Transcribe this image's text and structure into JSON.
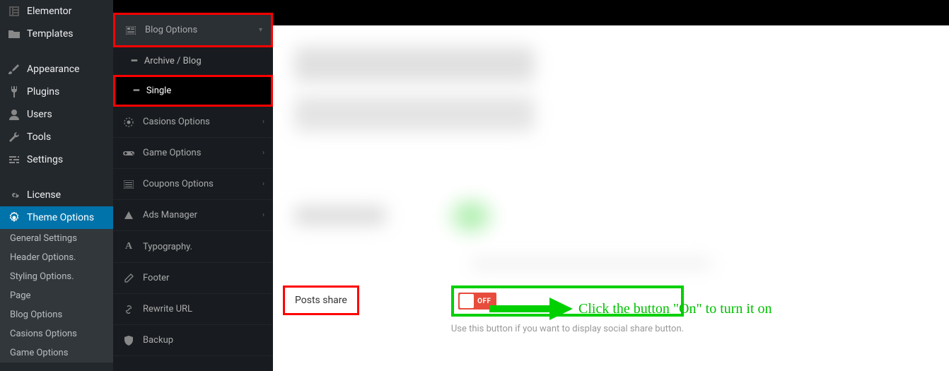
{
  "wp_sidebar": {
    "items": [
      {
        "label": "Elementor"
      },
      {
        "label": "Templates"
      },
      {
        "label": "Appearance"
      },
      {
        "label": "Plugins"
      },
      {
        "label": "Users"
      },
      {
        "label": "Tools"
      },
      {
        "label": "Settings"
      },
      {
        "label": "License"
      },
      {
        "label": "Theme Options"
      }
    ],
    "sub": [
      {
        "label": "General Settings"
      },
      {
        "label": "Header Options."
      },
      {
        "label": "Styling Options."
      },
      {
        "label": "Page"
      },
      {
        "label": "Blog Options"
      },
      {
        "label": "Casions Options"
      },
      {
        "label": "Game Options"
      }
    ]
  },
  "opts_sidebar": {
    "blog_options": "Blog Options",
    "archive": "Archive / Blog",
    "single": "Single",
    "items": [
      {
        "label": "Casions Options"
      },
      {
        "label": "Game Options"
      },
      {
        "label": "Coupons Options"
      },
      {
        "label": "Ads Manager"
      },
      {
        "label": "Typography."
      },
      {
        "label": "Footer"
      },
      {
        "label": "Rewrite URL"
      },
      {
        "label": "Backup"
      }
    ]
  },
  "content": {
    "posts_share_label": "Posts share",
    "toggle_state": "OFF",
    "help_text": "Use this button if you want to display social share button.",
    "annotation": "Click the button \"On\" to turn it on"
  }
}
